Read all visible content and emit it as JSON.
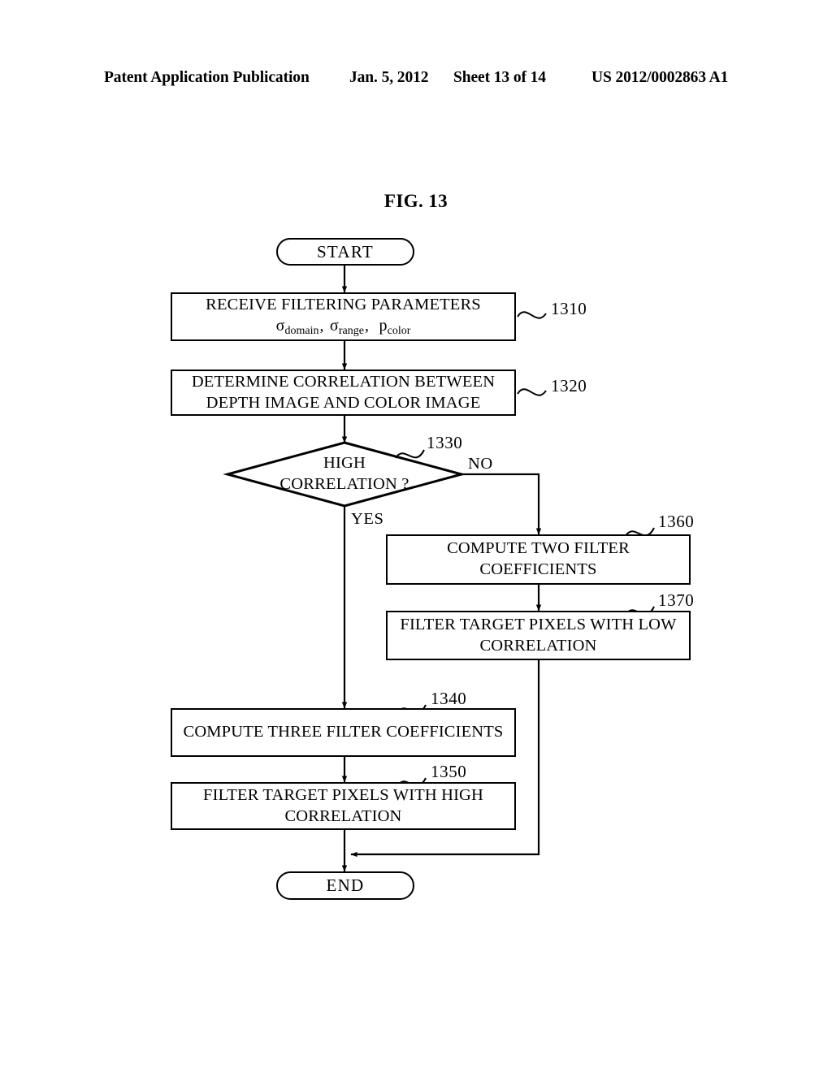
{
  "header": {
    "publication": "Patent Application Publication",
    "date": "Jan. 5, 2012",
    "sheet": "Sheet 13 of 14",
    "patent_number": "US 2012/0002863 A1"
  },
  "figure": {
    "title": "FIG. 13"
  },
  "flowchart": {
    "start": {
      "label": "START"
    },
    "end": {
      "label": "END"
    },
    "steps": [
      {
        "ref": "1310",
        "line1": "RECEIVE FILTERING PARAMETERS",
        "sigma": "σ",
        "rho": "p",
        "sub1": "domain",
        "sub2": "range",
        "sub3": "color",
        "formula_text": "σdomain , σrange , pcolor"
      },
      {
        "ref": "1320",
        "line1": "DETERMINE CORRELATION BETWEEN",
        "line2": "DEPTH IMAGE AND COLOR IMAGE"
      },
      {
        "ref": "1330",
        "line1": "HIGH",
        "line2": "CORRELATION ?"
      },
      {
        "ref": "1340",
        "line1": "COMPUTE THREE FILTER COEFFICIENTS"
      },
      {
        "ref": "1350",
        "line1": "FILTER TARGET PIXELS WITH HIGH",
        "line2": "CORRELATION"
      },
      {
        "ref": "1360",
        "line1": "COMPUTE TWO FILTER",
        "line2": "COEFFICIENTS"
      },
      {
        "ref": "1370",
        "line1": "FILTER TARGET PIXELS WITH LOW",
        "line2": "CORRELATION"
      }
    ],
    "branches": {
      "yes": "YES",
      "no": "NO"
    }
  }
}
